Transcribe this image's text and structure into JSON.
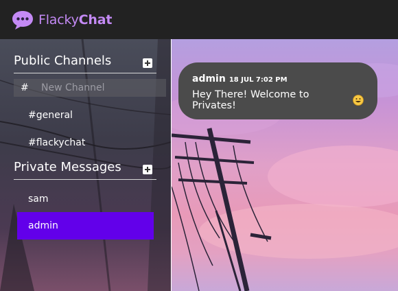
{
  "app": {
    "name_light": "Flacky",
    "name_bold": "Chat"
  },
  "sidebar": {
    "public_title": "Public Channels",
    "new_channel_hash": "#",
    "new_channel_placeholder": "New Channel",
    "channels": [
      "#general",
      "#flackychat"
    ],
    "private_title": "Private Messages",
    "users": [
      "sam",
      "admin"
    ],
    "active_user": "admin"
  },
  "messages": [
    {
      "user": "admin",
      "time": "18 JUL 7:02 PM",
      "text": "Hey There! Welcome to Privates!",
      "emoji": "grinning-face-icon"
    }
  ],
  "colors": {
    "brand": "#c48af5",
    "active": "#6200ea",
    "bubble": "#4b4b4b",
    "topbar": "#222222"
  }
}
